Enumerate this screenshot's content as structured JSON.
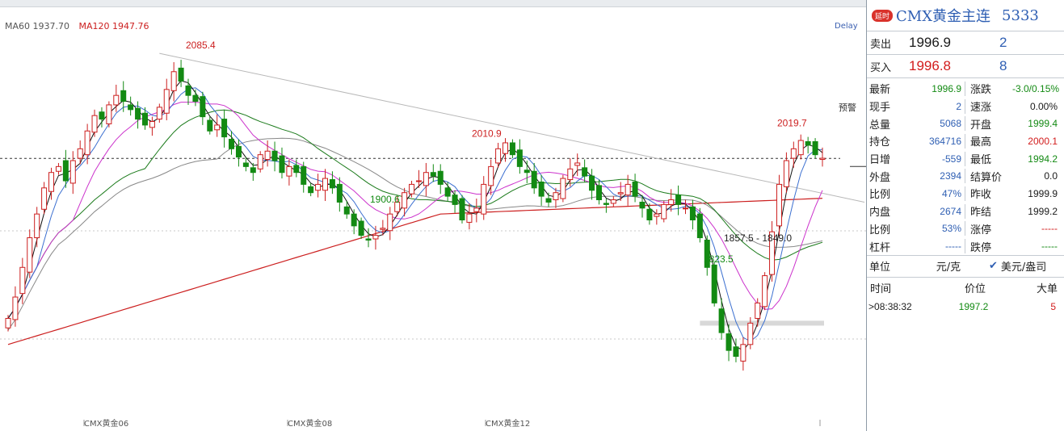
{
  "legend": {
    "ma60": "MA60 1937.70",
    "ma120": "MA120 1947.76",
    "ma60_color": "#555555",
    "ma120_color": "#cc1f1f"
  },
  "delay": "Delay",
  "alert_label": "预警",
  "annotations": [
    {
      "text": "2085.4",
      "color": "#cc1f1f"
    },
    {
      "text": "2010.9",
      "color": "#cc1f1f"
    },
    {
      "text": "1900.6",
      "color": "#138a13"
    },
    {
      "text": "2019.7",
      "color": "#cc1f1f"
    },
    {
      "text": "1823.5",
      "color": "#138a13"
    },
    {
      "text": "1857.5 - 1849.0",
      "color": "#222222"
    }
  ],
  "x_labels": [
    "CMX黄金06",
    "CMX黄金08",
    "CMX黄金12"
  ],
  "chart_data": {
    "type": "candlestick",
    "series_colors": {
      "up": "#cc1f1f",
      "down": "#138a13",
      "ma5": "#111111",
      "ma10": "#3b6fd0",
      "ma20": "#cc33cc",
      "ma30": "#1a7a1a",
      "ma60": "#888888",
      "ma120": "#cc1f1f"
    },
    "ylim": [
      1780,
      2110
    ],
    "close": [
      1862,
      1880,
      1905,
      1930,
      1950,
      1972,
      1985,
      1990,
      1978,
      1995,
      2005,
      2020,
      2033,
      2030,
      2042,
      2050,
      2045,
      2038,
      2030,
      2025,
      2028,
      2040,
      2055,
      2070,
      2062,
      2050,
      2045,
      2032,
      2020,
      2025,
      2015,
      2005,
      1998,
      1990,
      1985,
      2000,
      2003,
      1995,
      1985,
      1990,
      1985,
      1975,
      1968,
      1975,
      1980,
      1972,
      1960,
      1950,
      1940,
      1932,
      1928,
      1932,
      1938,
      1950,
      1960,
      1968,
      1975,
      1978,
      1985,
      1982,
      1975,
      1965,
      1958,
      1945,
      1950,
      1955,
      1975,
      1990,
      2005,
      2010,
      2000,
      1990,
      1985,
      1972,
      1965,
      1960,
      1968,
      1980,
      1988,
      1993,
      1982,
      1970,
      1962,
      1958,
      1962,
      1968,
      1975,
      1965,
      1955,
      1945,
      1950,
      1958,
      1962,
      1958,
      1955,
      1945,
      1930,
      1905,
      1875,
      1850,
      1835,
      1830,
      1840,
      1858,
      1875,
      1898,
      1935,
      1975,
      1995,
      2005,
      2012,
      2008,
      2000,
      1997
    ],
    "last_close": 1996.9,
    "notable": {
      "high_1": 2085.4,
      "high_2": 2010.9,
      "low_1": 1900.6,
      "high_3": 2019.7,
      "low_2": 1823.5,
      "alert_zone": [
        1857.5,
        1849.0
      ]
    }
  },
  "panel": {
    "badge": "延时",
    "name": "CMX黄金主连",
    "code": "5333",
    "ask": {
      "label": "卖出",
      "price": "1996.9",
      "volume": "2"
    },
    "bid": {
      "label": "买入",
      "price": "1996.8",
      "volume": "8"
    },
    "stats": [
      {
        "k1": "最新",
        "v1": "1996.9",
        "c1": "green",
        "k2": "涨跌",
        "v2": "-3.0/0.15%",
        "c2": "green"
      },
      {
        "k1": "现手",
        "v1": "2",
        "c1": "blue",
        "k2": "速涨",
        "v2": "0.00%",
        "c2": "dark"
      },
      {
        "k1": "总量",
        "v1": "5068",
        "c1": "blue",
        "k2": "开盘",
        "v2": "1999.4",
        "c2": "green"
      },
      {
        "k1": "持仓",
        "v1": "364716",
        "c1": "blue",
        "k2": "最高",
        "v2": "2000.1",
        "c2": "red"
      },
      {
        "k1": "日增",
        "v1": "-559",
        "c1": "blue",
        "k2": "最低",
        "v2": "1994.2",
        "c2": "green"
      },
      {
        "k1": "外盘",
        "v1": "2394",
        "c1": "blue",
        "k2": "结算价",
        "v2": "0.0",
        "c2": "dark"
      },
      {
        "k1": "比例",
        "v1": "47%",
        "c1": "blue",
        "k2": "昨收",
        "v2": "1999.9",
        "c2": "dark"
      },
      {
        "k1": "内盘",
        "v1": "2674",
        "c1": "blue",
        "k2": "昨结",
        "v2": "1999.2",
        "c2": "dark"
      },
      {
        "k1": "比例",
        "v1": "53%",
        "c1": "blue",
        "k2": "涨停",
        "v2": "-----",
        "c2": "red"
      },
      {
        "k1": "杠杆",
        "v1": "-----",
        "c1": "blue",
        "k2": "跌停",
        "v2": "-----",
        "c2": "green"
      }
    ],
    "unit": {
      "label": "单位",
      "opt1": "元/克",
      "check": "✔",
      "opt2": "美元/盎司"
    },
    "trades_header": {
      "time": "时间",
      "price": "价位",
      "big": "大单"
    },
    "trades": [
      {
        "time": "08:38:32",
        "price": "1997.2",
        "size": "5"
      }
    ]
  }
}
